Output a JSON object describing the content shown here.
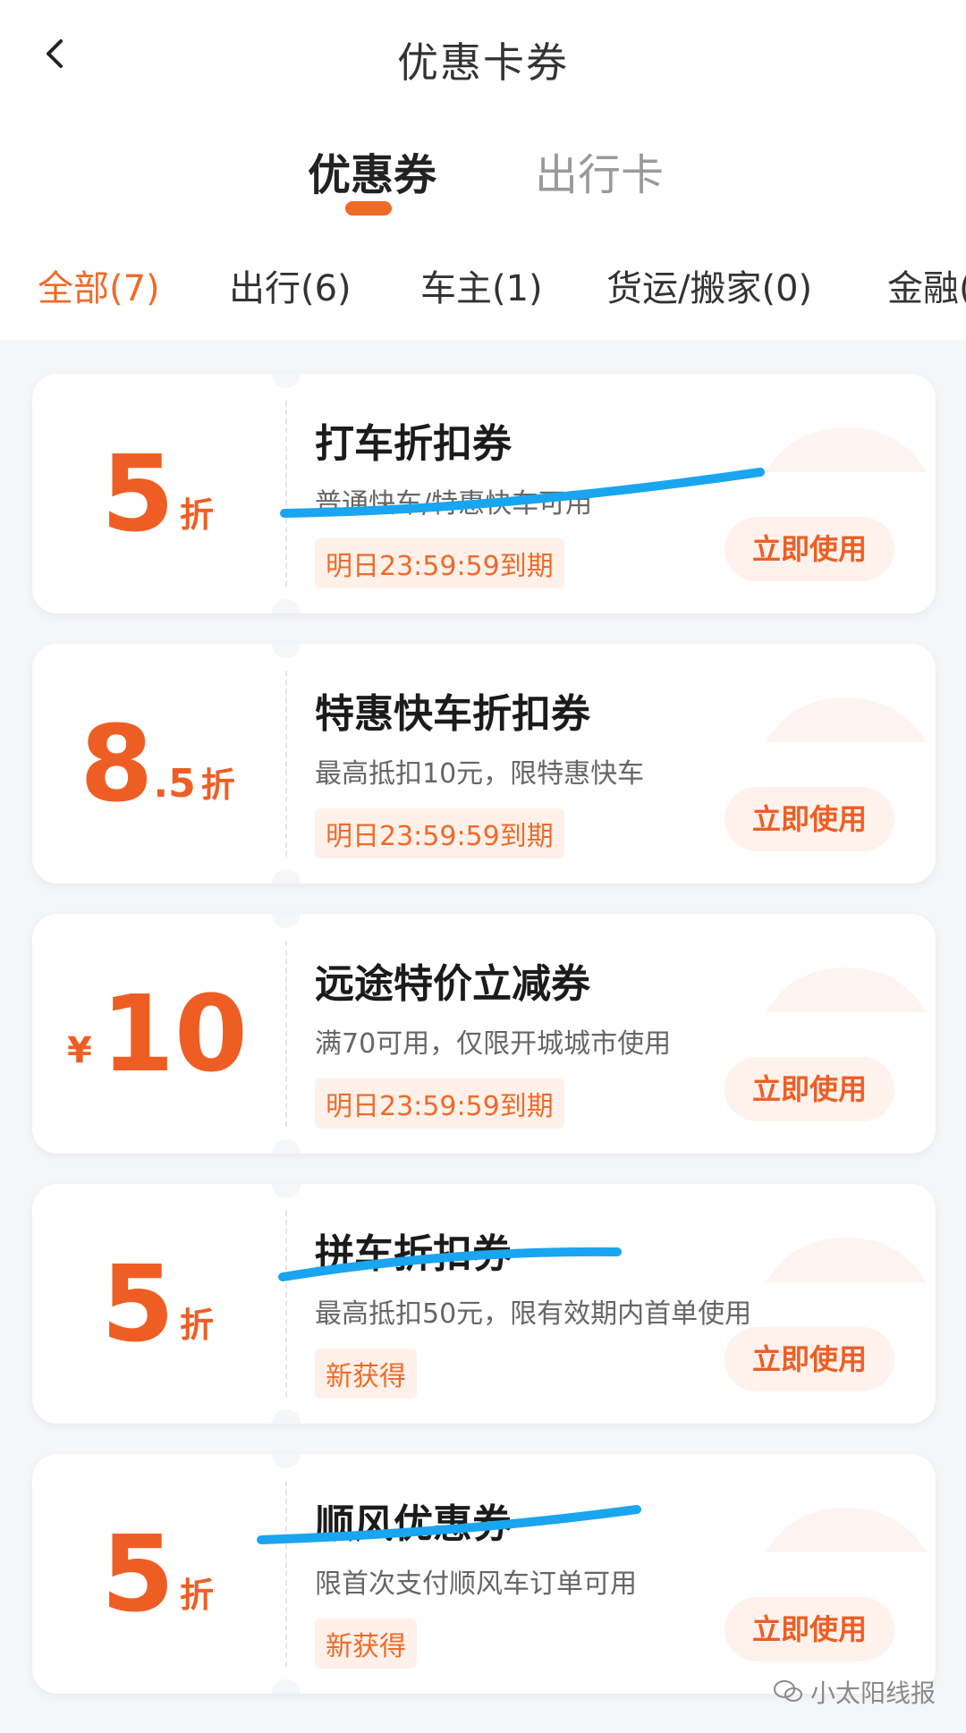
{
  "header": {
    "title": "优惠卡券",
    "back_icon": "chevron-left-icon"
  },
  "tabs": [
    {
      "label": "优惠券",
      "active": true
    },
    {
      "label": "出行卡",
      "active": false
    }
  ],
  "filters": [
    {
      "label": "全部(7)",
      "active": true
    },
    {
      "label": "出行(6)",
      "active": false
    },
    {
      "label": "车主(1)",
      "active": false
    },
    {
      "label": "货运/搬家(0)",
      "active": false
    },
    {
      "label": "金融(",
      "active": false
    }
  ],
  "coupons": [
    {
      "value": "5",
      "unit": "折",
      "title": "打车折扣券",
      "desc": "普通快车/特惠快车可用",
      "tag": "明日23:59:59到期",
      "button": "立即使用"
    },
    {
      "value": "8",
      "decimal": ".5",
      "unit": "折",
      "title": "特惠快车折扣券",
      "desc": "最高抵扣10元，限特惠快车",
      "tag": "明日23:59:59到期",
      "button": "立即使用"
    },
    {
      "currency": "¥",
      "value": "10",
      "title": "远途特价立减券",
      "desc": "满70可用，仅限开城城市使用",
      "tag": "明日23:59:59到期",
      "button": "立即使用"
    },
    {
      "value": "5",
      "unit": "折",
      "title": "拼车折扣券",
      "desc": "最高抵扣50元，限有效期内首单使用",
      "tag": "新获得",
      "button": "立即使用"
    },
    {
      "value": "5",
      "unit": "折",
      "title": "顺风优惠券",
      "desc": "限首次支付顺风车订单可用",
      "tag": "新获得",
      "button": "立即使用"
    }
  ],
  "watermark": {
    "text": "小太阳线报",
    "icon": "wechat-icon"
  },
  "colors": {
    "accent": "#f06a28",
    "highlight": "#19a5ef",
    "background": "#f5f6f8"
  }
}
